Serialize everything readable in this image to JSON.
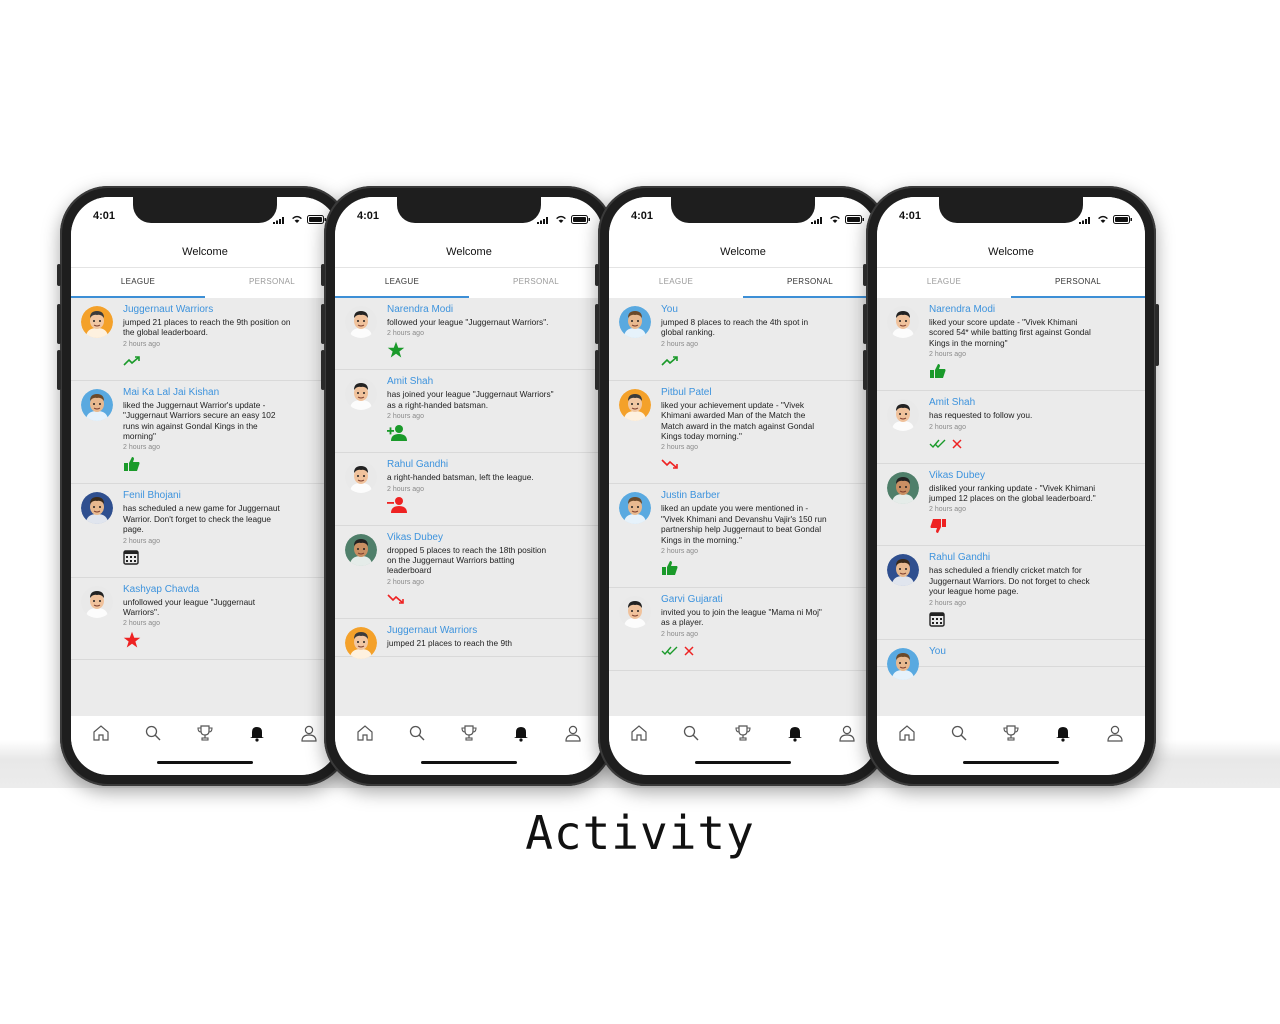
{
  "caption": "Activity",
  "colors": {
    "link": "#3d93dd",
    "green": "#1a9a2a",
    "red": "#ee2222",
    "tab_indicator": "#3d8fd6"
  },
  "common": {
    "time": "4:01",
    "title": "Welcome",
    "tab_league": "LEAGUE",
    "tab_personal": "PERSONAL"
  },
  "tabbar_icons": [
    "home-icon",
    "search-icon",
    "trophy-icon",
    "bell-icon",
    "profile-icon"
  ],
  "phones": [
    {
      "active_tab": "league",
      "items": [
        {
          "name": "Juggernaut Warriors",
          "text": "jumped 21 places to reach the 9th position on the global leaderboard.",
          "ago": "2 hours ago",
          "icon": "trend-up-icon",
          "avatar": "orange"
        },
        {
          "name": "Mai Ka Lal Jai Kishan",
          "text": "liked the Juggernaut Warrior's update - \"Juggernaut Warriors secure an easy 102 runs win against Gondal Kings in the morning\"",
          "ago": "2 hours ago",
          "icon": "thumbs-up-icon",
          "avatar": "blue"
        },
        {
          "name": "Fenil Bhojani",
          "text": "has scheduled a new game for Juggernaut Warrior. Don't forget to check the league page.",
          "ago": "2 hours ago",
          "icon": "calendar-icon",
          "avatar": "navy"
        },
        {
          "name": "Kashyap Chavda",
          "text": "unfollowed your league \"Juggernaut Warriors\".",
          "ago": "2 hours ago",
          "icon": "star-red-icon",
          "avatar": "light"
        }
      ]
    },
    {
      "active_tab": "league",
      "items": [
        {
          "name": "Narendra Modi",
          "text": "followed your league \"Juggernaut Warriors\".",
          "ago": "2 hours ago",
          "icon": "star-green-icon",
          "avatar": "light"
        },
        {
          "name": "Amit Shah",
          "text": "has joined your league \"Juggernaut Warriors\" as a right-handed batsman.",
          "ago": "2 hours ago",
          "icon": "person-add-icon",
          "avatar": "light"
        },
        {
          "name": "Rahul Gandhi",
          "text": "a right-handed batsman, left the league.",
          "ago": "2 hours ago",
          "icon": "person-remove-icon",
          "avatar": "light"
        },
        {
          "name": "Vikas Dubey",
          "text": "dropped 5 places to reach the 18th position on the Juggernaut Warriors batting leaderboard",
          "ago": "2 hours ago",
          "icon": "trend-down-icon",
          "avatar": "green"
        },
        {
          "name": "Juggernaut Warriors",
          "text": "jumped 21 places to reach the 9th",
          "ago": "",
          "icon": "",
          "avatar": "orange"
        }
      ]
    },
    {
      "active_tab": "personal",
      "items": [
        {
          "name": "You",
          "text": "jumped 8 places to reach the 4th spot in global ranking.",
          "ago": "2 hours ago",
          "icon": "trend-up-icon",
          "avatar": "blue"
        },
        {
          "name": "Pitbul Patel",
          "text": "liked your achievement update - \"Vivek Khimani awarded Man of the Match the Match award in the match against Gondal Kings today morning.\"",
          "ago": "2 hours ago",
          "icon": "trend-down-icon",
          "avatar": "orange"
        },
        {
          "name": "Justin Barber",
          "text": "liked an update you were mentioned in - \"Vivek Khimani and Devanshu Vajir's 150 run partnership help Juggernaut to beat Gondal Kings in the morning.\"",
          "ago": "2 hours ago",
          "icon": "thumbs-up-icon",
          "avatar": "blue"
        },
        {
          "name": "Garvi Gujarati",
          "text": "invited you to join the league \"Mama ni Moj\" as a player.",
          "ago": "2 hours ago",
          "icon": "accept-reject-icon",
          "avatar": "light"
        }
      ]
    },
    {
      "active_tab": "personal",
      "items": [
        {
          "name": "Narendra Modi",
          "text": "liked your score update - \"Vivek Khimani scored 54* while batting first against Gondal Kings in the morning\"",
          "ago": "2 hours ago",
          "icon": "thumbs-up-icon",
          "avatar": "light"
        },
        {
          "name": "Amit Shah",
          "text": "has requested to follow you.",
          "ago": "2 hours ago",
          "icon": "accept-reject-icon",
          "avatar": "light"
        },
        {
          "name": "Vikas Dubey",
          "text": "disliked your ranking update - \"Vivek Khimani jumped 12 places on the global leaderboard.\"",
          "ago": "2 hours ago",
          "icon": "thumbs-down-icon",
          "avatar": "green"
        },
        {
          "name": "Rahul Gandhi",
          "text": "has scheduled a friendly cricket match for Juggernaut Warriors. Do not forget to check your league home page.",
          "ago": "2 hours ago",
          "icon": "calendar-icon",
          "avatar": "navy"
        },
        {
          "name": "You",
          "text": "",
          "ago": "",
          "icon": "",
          "avatar": "blue"
        }
      ]
    }
  ]
}
